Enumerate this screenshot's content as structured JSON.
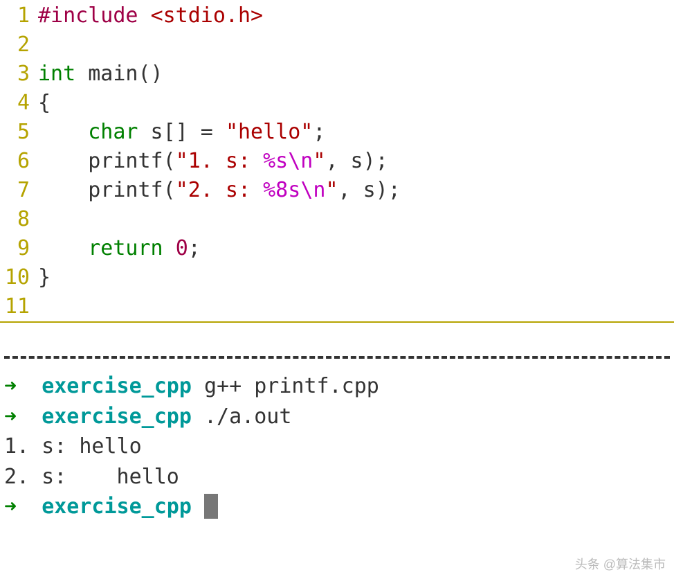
{
  "code": {
    "lines": [
      {
        "num": "1",
        "tokens": [
          {
            "cls": "preprocessor",
            "text": "#include "
          },
          {
            "cls": "angle-include",
            "text": "<stdio.h>"
          }
        ]
      },
      {
        "num": "2",
        "tokens": []
      },
      {
        "num": "3",
        "tokens": [
          {
            "cls": "keyword",
            "text": "int"
          },
          {
            "cls": "identifier",
            "text": " main()"
          }
        ]
      },
      {
        "num": "4",
        "tokens": [
          {
            "cls": "identifier",
            "text": "{"
          }
        ]
      },
      {
        "num": "5",
        "tokens": [
          {
            "cls": "identifier",
            "text": "    "
          },
          {
            "cls": "keyword",
            "text": "char"
          },
          {
            "cls": "identifier",
            "text": " s[] = "
          },
          {
            "cls": "string",
            "text": "\"hello\""
          },
          {
            "cls": "identifier",
            "text": ";"
          }
        ]
      },
      {
        "num": "6",
        "tokens": [
          {
            "cls": "identifier",
            "text": "    printf("
          },
          {
            "cls": "string",
            "text": "\"1. s: "
          },
          {
            "cls": "format-spec",
            "text": "%s"
          },
          {
            "cls": "format-spec",
            "text": "\\n"
          },
          {
            "cls": "string",
            "text": "\""
          },
          {
            "cls": "identifier",
            "text": ", s);"
          }
        ]
      },
      {
        "num": "7",
        "tokens": [
          {
            "cls": "identifier",
            "text": "    printf("
          },
          {
            "cls": "string",
            "text": "\"2. s: "
          },
          {
            "cls": "format-spec",
            "text": "%8s"
          },
          {
            "cls": "format-spec",
            "text": "\\n"
          },
          {
            "cls": "string",
            "text": "\""
          },
          {
            "cls": "identifier",
            "text": ", s);"
          }
        ]
      },
      {
        "num": "8",
        "tokens": []
      },
      {
        "num": "9",
        "tokens": [
          {
            "cls": "identifier",
            "text": "    "
          },
          {
            "cls": "keyword",
            "text": "return"
          },
          {
            "cls": "identifier",
            "text": " "
          },
          {
            "cls": "number",
            "text": "0"
          },
          {
            "cls": "identifier",
            "text": ";"
          }
        ]
      },
      {
        "num": "10",
        "tokens": [
          {
            "cls": "identifier",
            "text": "}"
          }
        ]
      },
      {
        "num": "11",
        "tokens": []
      }
    ]
  },
  "terminal": {
    "arrow": "➜",
    "prompt_dir": "exercise_cpp",
    "lines": [
      {
        "type": "prompt",
        "cmd": "g++ printf.cpp"
      },
      {
        "type": "prompt",
        "cmd": "./a.out"
      },
      {
        "type": "output",
        "text": "1. s: hello"
      },
      {
        "type": "output",
        "text": "2. s:    hello"
      },
      {
        "type": "prompt",
        "cmd": "",
        "cursor": true
      }
    ]
  },
  "watermark": "头条 @算法集市"
}
